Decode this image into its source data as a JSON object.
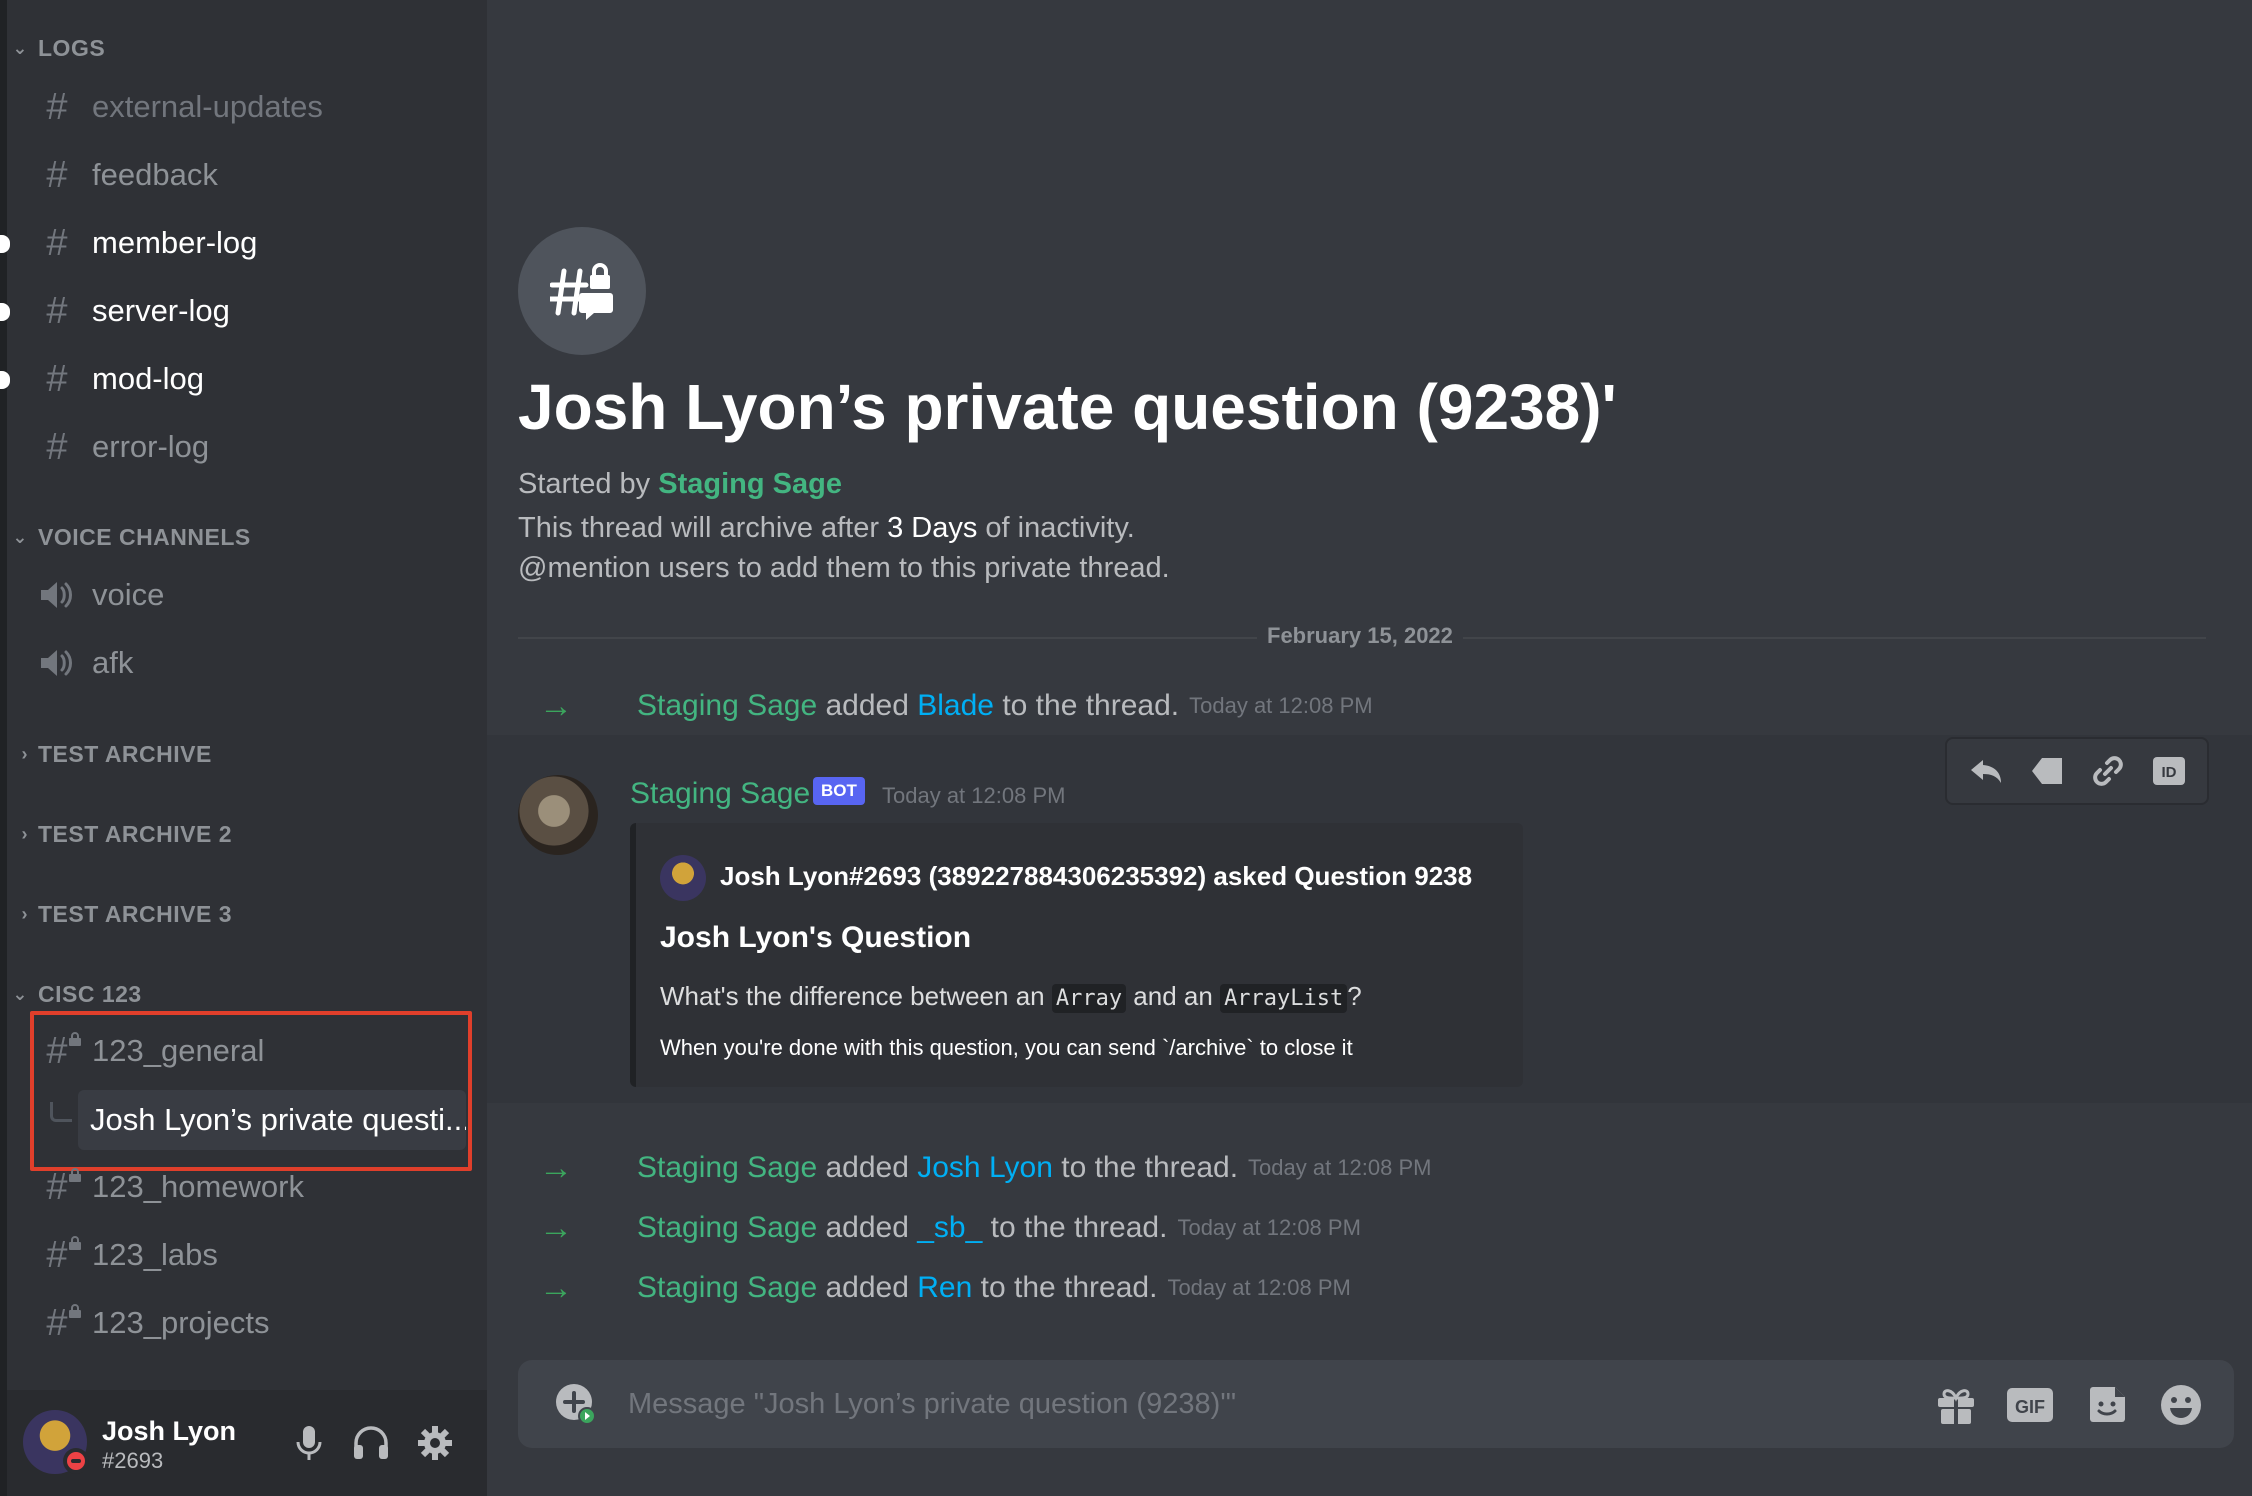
{
  "sidebar": {
    "categories": {
      "logs": "LOGS",
      "voice": "VOICE CHANNELS",
      "archive1": "TEST ARCHIVE",
      "archive2": "TEST ARCHIVE 2",
      "archive3": "TEST ARCHIVE 3",
      "cisc": "CISC 123"
    },
    "log_channels": [
      "external-updates",
      "feedback",
      "member-log",
      "server-log",
      "mod-log",
      "error-log"
    ],
    "voice_channels": [
      "voice",
      "afk"
    ],
    "cisc_channels": {
      "general": "123_general",
      "thread": "Josh Lyon’s private questi...",
      "homework": "123_homework",
      "labs": "123_labs",
      "projects": "123_projects"
    }
  },
  "user": {
    "name": "Josh Lyon",
    "tag": "#2693"
  },
  "thread": {
    "title": "Josh Lyon’s private question (9238)'",
    "started_by_prefix": "Started by ",
    "started_by_name": "Staging Sage",
    "archive_prefix": "This thread will archive after ",
    "archive_duration": "3 Days",
    "archive_suffix": " of inactivity.",
    "mention_hint": "@mention users to add them to this private thread."
  },
  "date_divider": "February 15, 2022",
  "system_messages": [
    {
      "actor": "Staging Sage",
      "verb": " added ",
      "target": "Blade",
      "suffix": " to the thread.",
      "ts": "Today at 12:08 PM"
    },
    {
      "actor": "Staging Sage",
      "verb": " added ",
      "target": "Josh Lyon",
      "suffix": " to the thread.",
      "ts": "Today at 12:08 PM"
    },
    {
      "actor": "Staging Sage",
      "verb": " added ",
      "target": "_sb_",
      "suffix": " to the thread.",
      "ts": "Today at 12:08 PM"
    },
    {
      "actor": "Staging Sage",
      "verb": " added ",
      "target": "Ren",
      "suffix": " to the thread.",
      "ts": "Today at 12:08 PM"
    }
  ],
  "bot_message": {
    "author": "Staging Sage",
    "tag": "BOT",
    "ts": "Today at 12:08 PM",
    "embed": {
      "author": "Josh Lyon#2693 (389227884306235392) asked Question 9238",
      "title": "Josh Lyon's Question",
      "desc_prefix": "What's the difference between an ",
      "code1": "Array",
      "desc_mid": " and an ",
      "code2": "ArrayList",
      "desc_suffix": "?",
      "footer": "When you're done with this question, you can send `/archive` to close it"
    }
  },
  "composer": {
    "placeholder": "Message \"Josh Lyon’s private question (9238)'\""
  },
  "colors": {
    "accent_green": "#43b581",
    "mention_blue": "#00aff4",
    "bot_badge": "#5865f2",
    "highlight": "#e03f2b"
  },
  "icons": [
    "hash-icon",
    "speaker-icon",
    "thread-lock-icon",
    "mic-icon",
    "headphones-icon",
    "gear-icon",
    "reply-icon",
    "tag-icon",
    "link-icon",
    "id-icon",
    "plus-icon",
    "gift-icon",
    "gif-icon",
    "sticker-icon",
    "emoji-icon"
  ]
}
